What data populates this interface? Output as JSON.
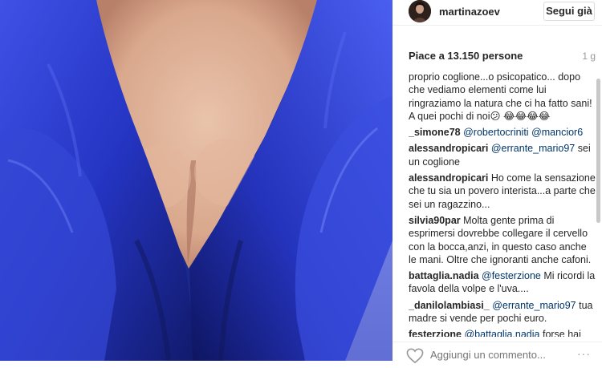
{
  "post": {
    "photo_icon": "portrait-photo",
    "username": "martinazoev",
    "follow_label": "Segui già",
    "likes": "Piace a 13.150 persone",
    "age": "1 g"
  },
  "comments": [
    {
      "author": "",
      "parts": [
        {
          "type": "text",
          "value": "proprio coglione...o psicopatico... dopo che vediamo elementi come lui ringraziamo la natura che ci ha fatto sani! A quei pochi di noi😕 😂😂😂😂"
        }
      ]
    },
    {
      "author": "_simone78",
      "parts": [
        {
          "type": "mention",
          "value": "@robertocriniti"
        },
        {
          "type": "text",
          "value": " "
        },
        {
          "type": "mention",
          "value": "@mancior6"
        }
      ]
    },
    {
      "author": "alessandropicari",
      "parts": [
        {
          "type": "mention",
          "value": "@errante_mario97"
        },
        {
          "type": "text",
          "value": " sei un coglione"
        }
      ]
    },
    {
      "author": "alessandropicari",
      "parts": [
        {
          "type": "text",
          "value": "Ho come la sensazione che tu sia un povero interista...a parte che sei un ragazzino..."
        }
      ]
    },
    {
      "author": "silvia90par",
      "parts": [
        {
          "type": "text",
          "value": "Molta gente prima di esprimersi dovrebbe collegare il cervello con la bocca,anzi, in questo caso anche le mani. Oltre che ignoranti anche cafoni."
        }
      ]
    },
    {
      "author": "battaglia.nadia",
      "parts": [
        {
          "type": "mention",
          "value": "@festerzione"
        },
        {
          "type": "text",
          "value": " Mi ricordi la favola della volpe e l'uva...."
        }
      ]
    },
    {
      "author": "_danilolambiasi_",
      "parts": [
        {
          "type": "mention",
          "value": "@errante_mario97"
        },
        {
          "type": "text",
          "value": " tua madre si vende per pochi euro."
        }
      ]
    },
    {
      "author": "festerzione",
      "parts": [
        {
          "type": "mention",
          "value": "@battaglia.nadia"
        },
        {
          "type": "text",
          "value": " forse hai sbagliato persona"
        }
      ]
    }
  ],
  "footer": {
    "heart_icon": "heart-outline",
    "comment_placeholder": "Aggiungi un commento...",
    "more_label": "···"
  },
  "colors": {
    "mention": "#003569",
    "muted": "#999999",
    "dress": "#2a3ad0"
  }
}
